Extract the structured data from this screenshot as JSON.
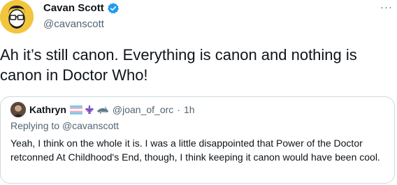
{
  "tweet": {
    "author_name": "Cavan Scott",
    "author_handle": "@cavanscott",
    "verified": true,
    "more_label": "···",
    "text": "Ah it’s still canon. Everything is canon and nothing is canon in Doctor Who!"
  },
  "quoted_tweet": {
    "author_name": "Kathryn",
    "author_handle": "@joan_of_orc",
    "separator": "·",
    "time": "1h",
    "emoji_icons": [
      "trans-flag-icon",
      "fleur-de-lis-icon",
      "shark-icon"
    ],
    "replying_prefix": "Replying to",
    "replying_to": "@cavanscott",
    "text": "Yeah, I think on the whole it is. I was a little disappointed that Power of the Doctor retconned At Childhood's End, though, I think keeping it canon would have been cool."
  },
  "colors": {
    "text_primary": "#0f1419",
    "text_secondary": "#536471",
    "verified_blue": "#1d9bf0",
    "border": "#cfd9de",
    "avatar_bg": "#f2c53d"
  }
}
